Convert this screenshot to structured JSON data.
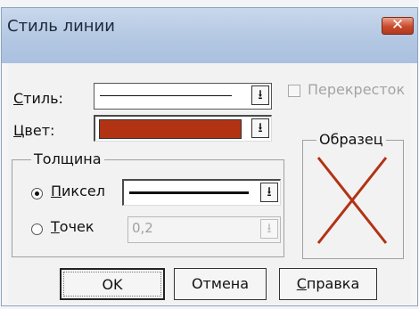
{
  "window": {
    "title": "Стиль линии"
  },
  "style_row": {
    "label": "Стиль:",
    "mnemonic": "С",
    "label_rest": "тиль:",
    "value": "solid-thin-line"
  },
  "crossing": {
    "label": "Перекресток",
    "checked": false,
    "enabled": false
  },
  "color_row": {
    "label": "Цвет:",
    "mnemonic": "Ц",
    "label_rest": "вет:",
    "value": "#b23314"
  },
  "thickness": {
    "title": "Толщина",
    "pixels": {
      "label": "Пиксел",
      "mnemonic": "П",
      "label_rest": "иксел",
      "selected": true
    },
    "points": {
      "label": "Точек",
      "mnemonic": "Т",
      "label_rest": "очек",
      "selected": false,
      "value": "0,2",
      "enabled": false
    }
  },
  "sample": {
    "title": "Образец",
    "color": "#b23314"
  },
  "buttons": {
    "ok": "OK",
    "cancel": "Отмена",
    "help": "Справка",
    "help_mnemonic": "С",
    "help_rest": "правка"
  },
  "icons": {
    "dropdown": "⭳",
    "close": "✕"
  }
}
